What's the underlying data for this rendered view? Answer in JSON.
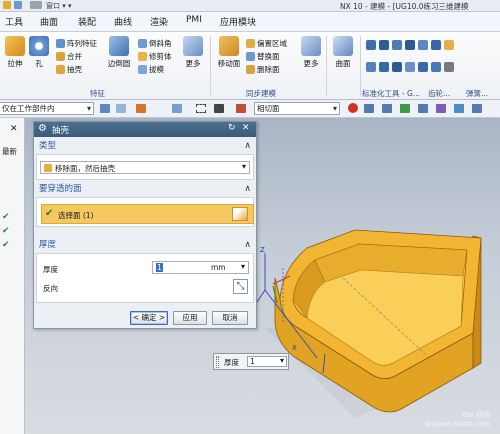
{
  "titlebar": {
    "menu_label": "窗口 ▾ ▾",
    "app_title": "NX 10 - 建模 - [UG10.0练习三维建模"
  },
  "tabs": [
    "工具",
    "曲面",
    "装配",
    "曲线",
    "渲染",
    "PMI",
    "应用模块"
  ],
  "ribbon": {
    "feature_big": [
      "拉伸",
      "孔",
      "边倒圆",
      "更多"
    ],
    "feature_small": [
      "阵列特征",
      "合并",
      "抽壳",
      "倒斜角",
      "修剪体",
      "拔模"
    ],
    "feature_group": "特征",
    "sync_big": [
      "移动面",
      "更多"
    ],
    "sync_small": [
      "偏置区域",
      "替换面",
      "删除面"
    ],
    "sync_group": "同步建模",
    "surface_big": [
      "曲面"
    ],
    "std_group": "标准化工具 - G...",
    "gear_group": "齿轮...",
    "spring_group": "弹簧..."
  },
  "filterbar": {
    "scope": "仅在工作部件内",
    "face_rule": "相切面"
  },
  "leftpanel": {
    "refresh_label": "最新"
  },
  "dialog": {
    "title": "抽壳",
    "type_header": "类型",
    "type_value": "移除面，然后抽壳",
    "pierce_header": "要穿透的面",
    "select_face": "选择面 (1)",
    "thickness_header": "厚度",
    "thickness_label": "厚度",
    "thickness_value": "1",
    "thickness_unit": "mm",
    "reverse_label": "反向",
    "ok": "< 确定 >",
    "apply": "应用",
    "cancel": "取消"
  },
  "floatbox": {
    "label": "厚度",
    "value": "1"
  },
  "axis_labels": {
    "z": "Z",
    "x": "X"
  },
  "watermark": {
    "line1": "Bai 经验",
    "line2": "jingyan.baidu.com"
  },
  "colors": {
    "accent": "#f5c860",
    "part": "#f2b632",
    "dialog_header": "#3a5c7a"
  }
}
